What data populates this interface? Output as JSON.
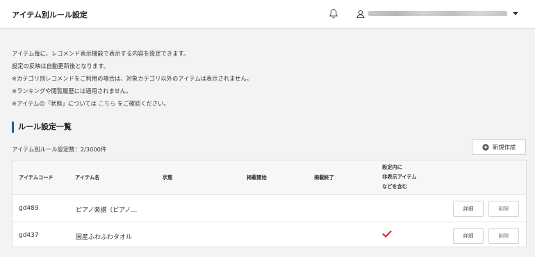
{
  "header": {
    "title": "アイテム別ルール設定",
    "account": "████████████████████"
  },
  "description": {
    "line1": "アイテム毎に、レコメンド表示機能で表示する内容を設定できます。",
    "line2": "設定の反映は自動更新後となります。",
    "line3": "※カテゴリ別レコメンドをご利用の場合は、対象カテゴリ以外のアイテムは表示されません。",
    "line4": "※ランキングや閲覧履歴には適用されません。",
    "line5_prefix": "※アイテムの「状態」については",
    "line5_link": "こちら",
    "line5_suffix": "をご確認ください。"
  },
  "section": {
    "title": "ルール設定一覧",
    "count": "アイテム別ルール設定数：2/3000件",
    "new_button": "新規作成"
  },
  "table": {
    "headers": {
      "code": "アイテムコード",
      "name": "アイテム名",
      "status": "状態",
      "start": "掲載開始",
      "end": "掲載終了",
      "hidden_line1": "設定内に",
      "hidden_line2": "非表示アイテム",
      "hidden_line3": "などを含む"
    },
    "rows": [
      {
        "code": "gd489",
        "name": "ピアノ楽譜（ピアノ…",
        "status": "",
        "start": "",
        "end": "",
        "includes_hidden": false,
        "detail": "詳細",
        "delete": "削除"
      },
      {
        "code": "gd437",
        "name": "国産ふわふわタオル",
        "status": "",
        "start": "",
        "end": "",
        "includes_hidden": true,
        "detail": "詳細",
        "delete": "削除"
      }
    ]
  },
  "colors": {
    "accent": "#1a5fb4",
    "link": "#2a6fc9",
    "check": "#d8283c"
  },
  "icons": {
    "bell": "bell-icon",
    "user": "user-icon",
    "caret": "caret-down-icon",
    "plus": "plus-circle-icon",
    "check": "check-icon"
  }
}
